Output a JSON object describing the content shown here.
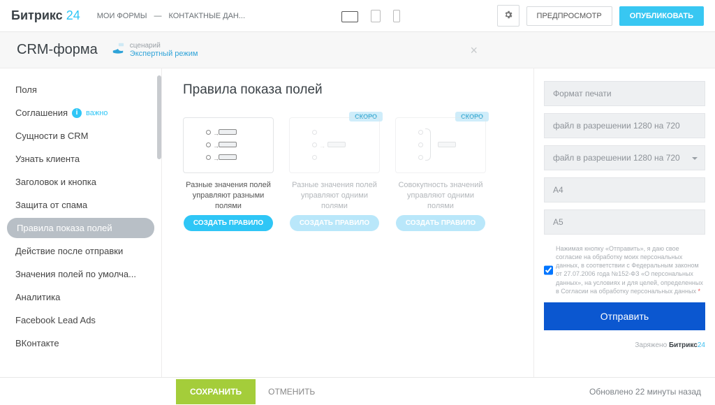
{
  "brand": {
    "p1": "Битрикс",
    "p2": "24"
  },
  "breadcrumb": {
    "myforms": "МОИ ФОРМЫ",
    "contact": "КОНТАКТНЫЕ ДАН..."
  },
  "header": {
    "preview": "ПРЕДПРОСМОТР",
    "publish": "ОПУБЛИКОВАТЬ"
  },
  "subheader": {
    "title": "CRM-форма",
    "scenario": "сценарий",
    "expert": "Экспертный режим"
  },
  "nav": {
    "fields": "Поля",
    "agreements": "Соглашения",
    "important": "важно",
    "crm_entities": "Сущности в CRM",
    "know_client": "Узнать клиента",
    "header_button": "Заголовок и кнопка",
    "spam": "Защита от спама",
    "rules": "Правила показа полей",
    "after_submit": "Действие после отправки",
    "defaults": "Значения полей по умолча...",
    "analytics": "Аналитика",
    "fb": "Facebook Lead Ads",
    "vk": "ВКонтакте"
  },
  "main": {
    "title": "Правила показа полей",
    "soon": "СКОРО",
    "card1_desc": "Разные значения полей управляют разными полями",
    "card2_desc": "Разные значения полей управляют одними полями",
    "card3_desc": "Совокупность значений управляют одними полями",
    "create": "СОЗДАТЬ ПРАВИЛО"
  },
  "preview": {
    "f1": "Формат печати",
    "f2": "файл в разрешении 1280 на 720",
    "f3": "файл в разрешении 1280 на 720",
    "f4": "A4",
    "f5": "A5",
    "consent": "Нажимая кнопку «Отправить», я даю свое согласие на обработку моих персональных данных, в соответствии с Федеральным законом от 27.07.2006 года №152-ФЗ «О персональных данных», на условиях и для целей, определенных в Согласии на обработку персональных данных",
    "submit": "Отправить",
    "powered": "Заряжено",
    "powered_brand1": "Битрикс",
    "powered_brand2": "24"
  },
  "bottom": {
    "save": "СОХРАНИТЬ",
    "cancel": "ОТМЕНИТЬ",
    "updated": "Обновлено 22 минуты назад"
  }
}
